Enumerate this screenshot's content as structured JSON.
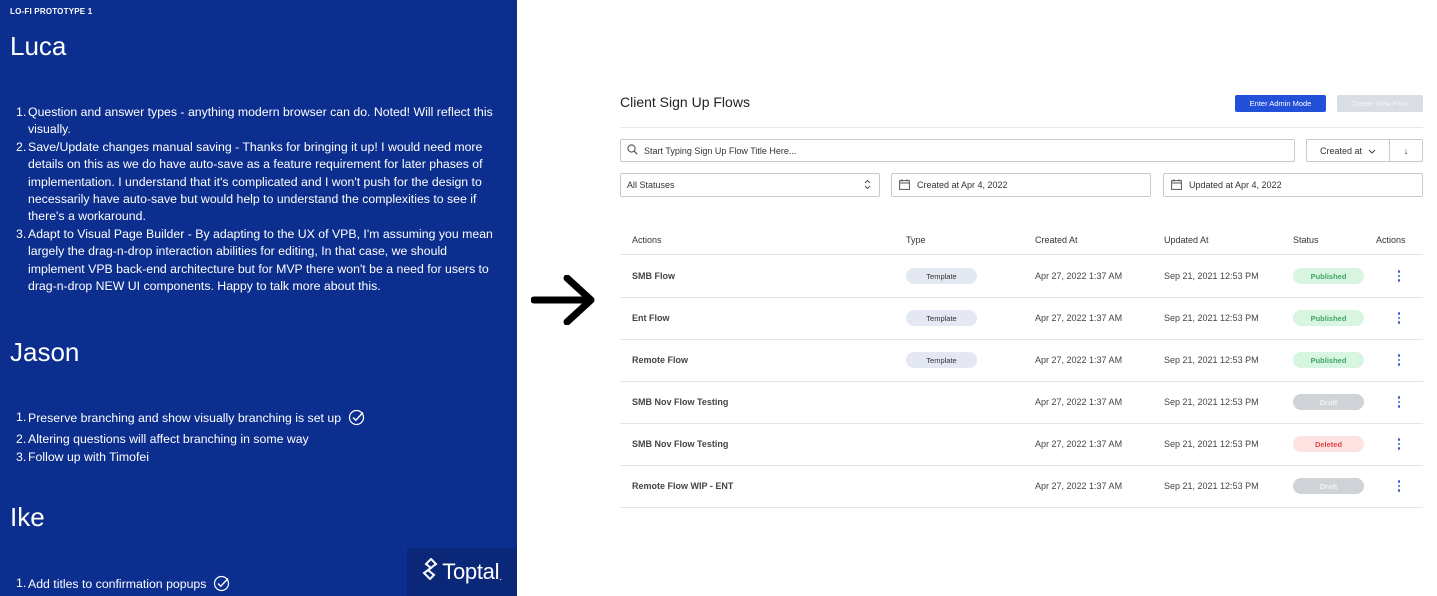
{
  "notes_panel": {
    "header": "LO-FI PROTOTYPE 1",
    "sections": [
      {
        "name": "Luca",
        "items": [
          {
            "num": "1.",
            "lines": [
              "Question and answer types - anything modern browser can do. Noted! Will reflect this",
              "visually."
            ]
          },
          {
            "num": "2.",
            "lines": [
              "Save/Update changes manual saving - Thanks for bringing it up! I would need more",
              "details on this as we do have auto-save as a feature requirement for later phases of",
              "implementation. I understand that it's complicated and I won't push for the design to",
              "necessarily have auto-save but would help to understand the complexities to see if",
              "there's a workaround."
            ]
          },
          {
            "num": "3.",
            "lines": [
              "Adapt to Visual Page Builder - By adapting to the UX of VPB, I'm assuming you mean",
              "largely the drag-n-drop interaction abilities for editing, In that case, we should",
              "implement VPB back-end architecture but for MVP there won't be a need for users to",
              "drag-n-drop NEW UI components. Happy to talk more about this."
            ]
          }
        ]
      },
      {
        "name": "Jason",
        "items": [
          {
            "num": "1.",
            "lines": [
              "Preserve branching and show visually branching is set up"
            ],
            "checked": true
          },
          {
            "num": "2.",
            "lines": [
              "Altering questions will affect branching in some way"
            ]
          },
          {
            "num": "3.",
            "lines": [
              "Follow up with Timofei"
            ]
          }
        ]
      },
      {
        "name": "Ike",
        "items": [
          {
            "num": "1.",
            "lines": [
              "Add titles to confirmation popups"
            ],
            "checked": true
          }
        ]
      }
    ],
    "logo_text": "Toptal",
    "logo_mark": "."
  },
  "app": {
    "title": "Client Sign Up Flows",
    "admin_button": "Enter Admin Mode",
    "create_button": "Create New Flow",
    "search_placeholder": "Start Typing Sign Up Flow Title Here...",
    "sort_label": "Created at",
    "sort_direction": "↓",
    "status_filter": "All Statuses",
    "created_filter": "Created at Apr 4, 2022",
    "updated_filter": "Updated at Apr 4, 2022",
    "columns": [
      "Actions",
      "Type",
      "Created At",
      "Updated At",
      "Status",
      "Actions"
    ],
    "rows": [
      {
        "name": "SMB Flow",
        "type": "Template",
        "created": "Apr 27, 2022 1:37 AM",
        "updated": "Sep 21, 2021 12:53 PM",
        "status": "Published"
      },
      {
        "name": "Ent Flow",
        "type": "Template",
        "created": "Apr 27, 2022 1:37 AM",
        "updated": "Sep 21, 2021 12:53 PM",
        "status": "Published"
      },
      {
        "name": "Remote Flow",
        "type": "Template",
        "created": "Apr 27, 2022 1:37 AM",
        "updated": "Sep 21, 2021 12:53 PM",
        "status": "Published"
      },
      {
        "name": "SMB Nov Flow Testing",
        "type": "",
        "created": "Apr 27, 2022 1:37 AM",
        "updated": "Sep 21, 2021 12:53 PM",
        "status": "Draft"
      },
      {
        "name": "SMB Nov Flow Testing",
        "type": "",
        "created": "Apr 27, 2022 1:37 AM",
        "updated": "Sep 21, 2021 12:53 PM",
        "status": "Deleted"
      },
      {
        "name": "Remote Flow WIP - ENT",
        "type": "",
        "created": "Apr 27, 2022 1:37 AM",
        "updated": "Sep 21, 2021 12:53 PM",
        "status": "Draft"
      }
    ]
  },
  "colors": {
    "panel_bg": "#0c2f8f",
    "primary_button": "#2350d8",
    "published": "#3ea766",
    "deleted": "#e24747",
    "draft": "#cfd2d6"
  },
  "icons": [
    "check-circle-icon",
    "toptal-logo-icon",
    "right-arrow-icon",
    "search-icon",
    "chevron-down-icon",
    "sort-direction-icon",
    "select-arrows-icon",
    "calendar-icon",
    "kebab-menu-icon"
  ]
}
